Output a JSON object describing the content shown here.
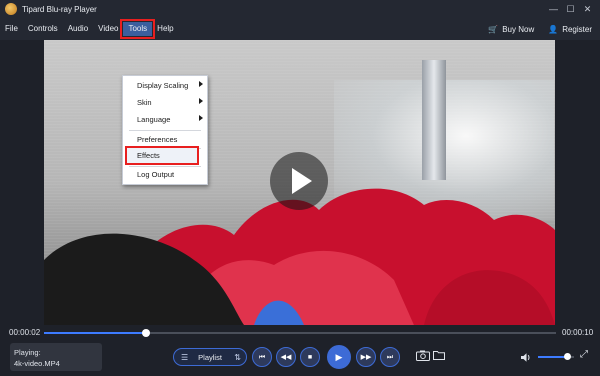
{
  "window": {
    "title": "Tipard Blu-ray Player",
    "controls": [
      "minimize-icon",
      "maximize-icon",
      "close-icon"
    ]
  },
  "menubar": {
    "items": [
      "File",
      "Controls",
      "Audio",
      "Video",
      "Tools",
      "Help"
    ],
    "active": "Tools",
    "buy_now": "Buy Now",
    "register": "Register"
  },
  "tools_menu": {
    "items": [
      {
        "label": "Display Scaling",
        "submenu": true
      },
      {
        "label": "Skin",
        "submenu": true
      },
      {
        "label": "Language",
        "submenu": true
      },
      {
        "label": "Preferences",
        "submenu": false
      },
      {
        "label": "Effects",
        "submenu": false,
        "highlighted": true
      },
      {
        "label": "Log Output",
        "submenu": false
      }
    ]
  },
  "playback": {
    "current_time": "00:00:02",
    "total_time": "00:00:10",
    "progress": 0.2,
    "volume": 0.82
  },
  "now_playing": {
    "label": "Playing:",
    "file": "4k-video.MP4"
  },
  "controls": {
    "playlist_label": "Playlist",
    "buttons": [
      "previous-icon",
      "rewind-icon",
      "stop-icon",
      "play-icon",
      "fast-forward-icon",
      "next-icon",
      "snapshot-icon",
      "open-folder-icon",
      "volume-icon",
      "fullscreen-icon"
    ]
  },
  "colors": {
    "accent": "#3d6bd6",
    "highlight_box": "#e81f1f",
    "background": "#1e2129"
  }
}
